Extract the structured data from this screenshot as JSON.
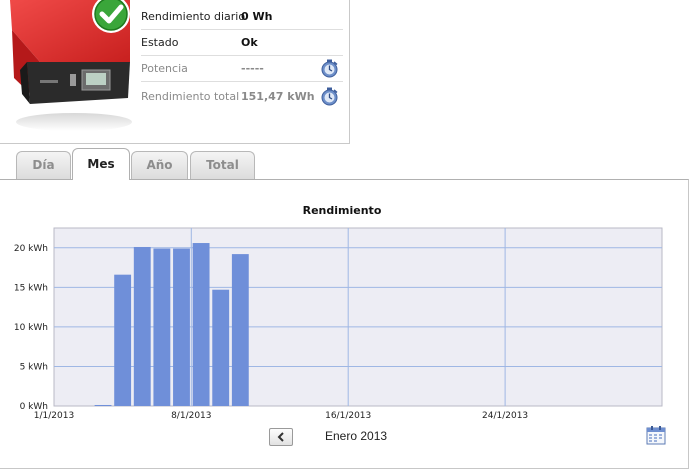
{
  "status": {
    "rows": [
      {
        "label": "Rendimiento diario",
        "value": "0  Wh",
        "style": "strong"
      },
      {
        "label": "Estado",
        "value": "Ok",
        "style": "strong"
      },
      {
        "label": "Potencia",
        "value": "-----",
        "style": "muted",
        "refresh_icon": "refresh-icon"
      },
      {
        "label": "Rendimiento total",
        "value": "151,47  kWh",
        "style": "muted",
        "refresh_icon": "refresh-icon"
      }
    ],
    "status_icon": "check-circle-icon"
  },
  "tabs": [
    {
      "label": "Día",
      "active": false
    },
    {
      "label": "Mes",
      "active": true
    },
    {
      "label": "Año",
      "active": false
    },
    {
      "label": "Total",
      "active": false
    }
  ],
  "chart_data": {
    "type": "bar",
    "title": "Rendimiento",
    "xlabel": "",
    "ylabel": "",
    "x_ticks": [
      "1/1/2013",
      "8/1/2013",
      "16/1/2013",
      "24/1/2013"
    ],
    "y_ticks": [
      "0 kWh",
      "5 kWh",
      "10 kWh",
      "15 kWh",
      "20 kWh"
    ],
    "ylim": [
      0,
      22.5
    ],
    "grid": true,
    "series": [
      {
        "days": [
          3,
          4,
          5,
          6,
          7,
          8,
          9,
          10
        ],
        "values": [
          0.1,
          16.6,
          20.1,
          19.9,
          19.9,
          20.6,
          14.7,
          19.2
        ]
      }
    ],
    "colors": {
      "bar": "#6f8fd9",
      "plot_background": "#ededf4",
      "grid": "#9fb7e4"
    }
  },
  "footer": {
    "prev_label": "previous-month",
    "period_label": "Enero 2013",
    "calendar_icon": "calendar-icon"
  }
}
